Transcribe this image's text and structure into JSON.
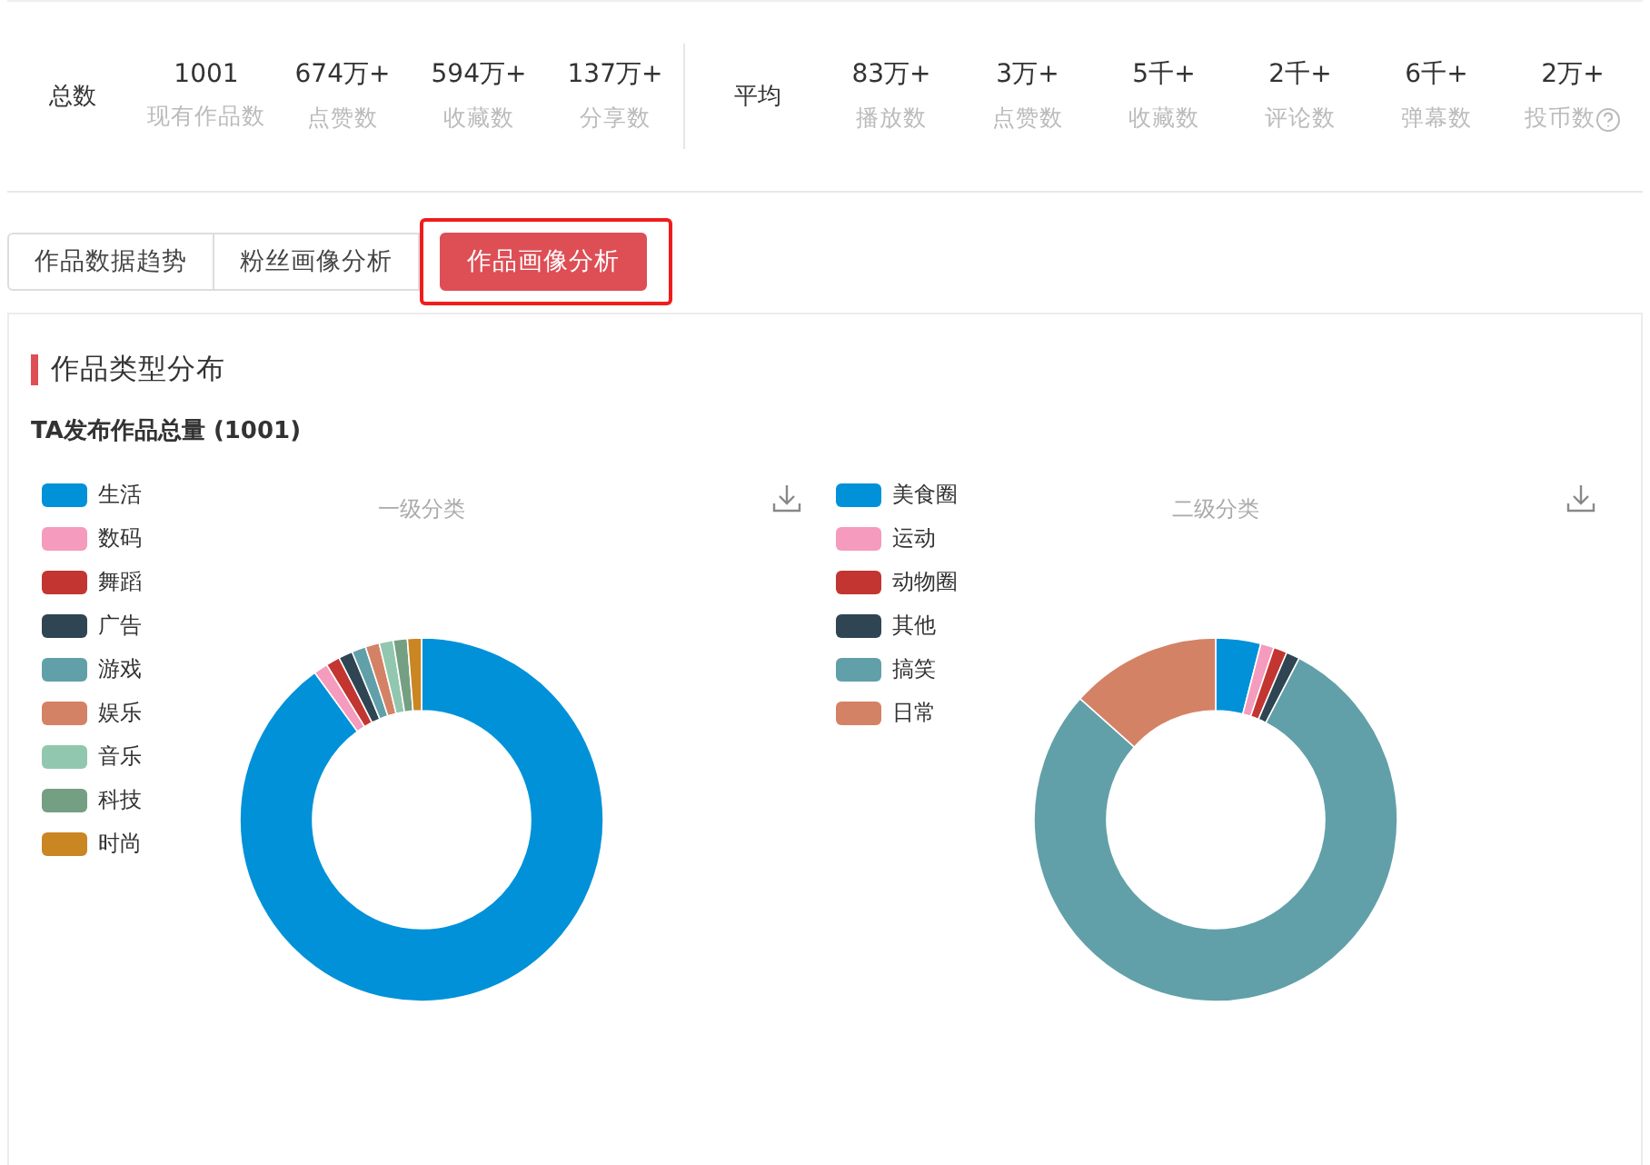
{
  "summary": {
    "total": {
      "label": "总数",
      "stats": [
        {
          "value": "1001",
          "label": "现有作品数"
        },
        {
          "value": "674万+",
          "label": "点赞数"
        },
        {
          "value": "594万+",
          "label": "收藏数"
        },
        {
          "value": "137万+",
          "label": "分享数"
        }
      ]
    },
    "average": {
      "label": "平均",
      "stats": [
        {
          "value": "83万+",
          "label": "播放数"
        },
        {
          "value": "3万+",
          "label": "点赞数"
        },
        {
          "value": "5千+",
          "label": "收藏数"
        },
        {
          "value": "2千+",
          "label": "评论数"
        },
        {
          "value": "6千+",
          "label": "弹幕数"
        },
        {
          "value": "2万+",
          "label": "投币数",
          "help": true
        }
      ]
    }
  },
  "tabs": [
    {
      "label": "作品数据趋势",
      "selected": false
    },
    {
      "label": "粉丝画像分析",
      "selected": false
    },
    {
      "label": "作品画像分析",
      "selected": true,
      "highlighted": true
    }
  ],
  "section": {
    "title": "作品类型分布",
    "subtitle": "TA发布作品总量 (1001)",
    "charts": [
      {
        "title": "一级分类",
        "legend": [
          {
            "label": "生活",
            "color": "#0091d9"
          },
          {
            "label": "数码",
            "color": "#f59bbd"
          },
          {
            "label": "舞蹈",
            "color": "#c23531"
          },
          {
            "label": "广告",
            "color": "#2f4554"
          },
          {
            "label": "游戏",
            "color": "#61a0a8"
          },
          {
            "label": "娱乐",
            "color": "#d48265"
          },
          {
            "label": "音乐",
            "color": "#91c7ae"
          },
          {
            "label": "科技",
            "color": "#749f83"
          },
          {
            "label": "时尚",
            "color": "#ca8622"
          }
        ]
      },
      {
        "title": "二级分类",
        "legend": [
          {
            "label": "美食圈",
            "color": "#0091d9"
          },
          {
            "label": "运动",
            "color": "#f59bbd"
          },
          {
            "label": "动物圈",
            "color": "#c23531"
          },
          {
            "label": "其他",
            "color": "#2f4554"
          },
          {
            "label": "搞笑",
            "color": "#61a0a8"
          },
          {
            "label": "日常",
            "color": "#d48265"
          }
        ]
      }
    ]
  }
}
